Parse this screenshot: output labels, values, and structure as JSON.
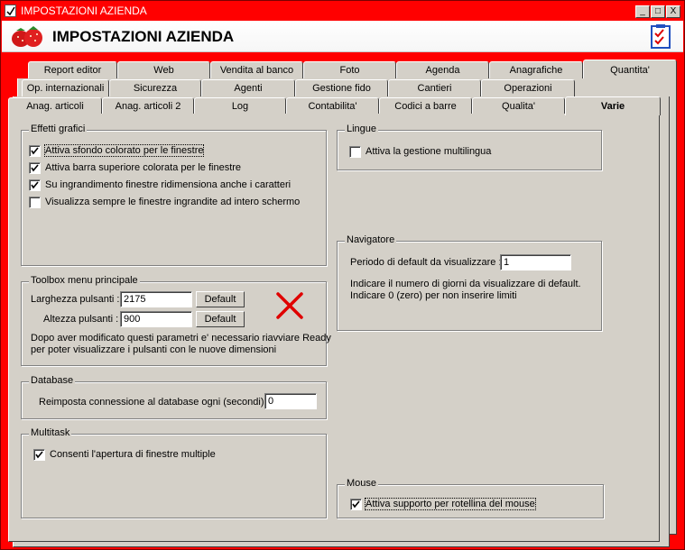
{
  "window": {
    "title": "IMPOSTAZIONI AZIENDA",
    "controls": {
      "minimize": "_",
      "maximize": "□",
      "close": "X"
    }
  },
  "header": {
    "title": "IMPOSTAZIONI AZIENDA",
    "logo_icon": "strawberry-logo-icon",
    "right_icon": "checklist-icon"
  },
  "tabs": {
    "row1": [
      "Report editor",
      "Web",
      "Vendita al banco",
      "Foto",
      "Agenda",
      "Anagrafiche",
      "Quantita'"
    ],
    "row2": [
      "Op. internazionali",
      "Sicurezza",
      "Agenti",
      "Gestione fido",
      "Cantieri",
      "Operazioni"
    ],
    "row3": [
      "Anag. articoli",
      "Anag. articoli 2",
      "Log",
      "Contabilita'",
      "Codici a barre",
      "Qualita'",
      "Varie"
    ],
    "active": "Varie"
  },
  "effetti": {
    "legend": "Effetti grafici",
    "items": [
      {
        "label": "Attiva sfondo colorato per le finestre",
        "checked": true
      },
      {
        "label": "Attiva barra superiore colorata per le finestre",
        "checked": true
      },
      {
        "label": "Su ingrandimento finestre ridimensiona anche i caratteri",
        "checked": true
      },
      {
        "label": "Visualizza sempre le finestre ingrandite ad intero schermo",
        "checked": false
      }
    ]
  },
  "lingue": {
    "legend": "Lingue",
    "label": "Attiva la gestione multilingua",
    "checked": false
  },
  "toolbox": {
    "legend": "Toolbox menu principale",
    "width_label": "Larghezza pulsanti :",
    "width_value": "2175",
    "height_label": "Altezza pulsanti :",
    "height_value": "900",
    "default_label": "Default",
    "note1": "Dopo aver modificato questi parametri e' necessario riavviare Ready",
    "note2": "per poter visualizzare i pulsanti con le nuove dimensioni",
    "reset_icon": "red-x-icon"
  },
  "navigatore": {
    "legend": "Navigatore",
    "period_label": "Periodo di default da visualizzare :",
    "period_value": "1",
    "note1": "Indicare il numero di giorni da visualizzare di default.",
    "note2": "Indicare 0 (zero) per non inserire limiti"
  },
  "database": {
    "legend": "Database",
    "label": "Reimposta connessione al database ogni (secondi) :",
    "value": "0"
  },
  "multitask": {
    "legend": "Multitask",
    "label": "Consenti l'apertura di finestre multiple",
    "checked": true
  },
  "mouse": {
    "legend": "Mouse",
    "label": "Attiva supporto per rotellina del mouse",
    "checked": true
  },
  "colors": {
    "window_bg": "#ff0000",
    "face": "#d4d0c8",
    "accent_red": "#e00000"
  }
}
